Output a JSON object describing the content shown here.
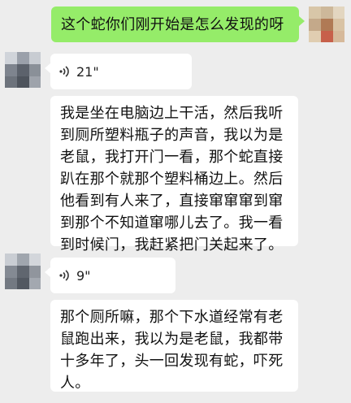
{
  "messages": [
    {
      "from": "me",
      "type": "text",
      "text": "这个蛇你们刚开始是怎么发现的呀"
    },
    {
      "from": "other",
      "type": "voice",
      "duration": "21\""
    },
    {
      "from": "other",
      "type": "text",
      "text": "我是坐在电脑边上干活，然后我听到厕所塑料瓶子的声音，我以为是老鼠，我打开门一看，那个蛇直接趴在那个就那个塑料桶边上。然后他看到有人来了，直接窜窜窜到窜到那个不知道窜哪儿去了。我一看到时候门，我赶紧把门关起来了。"
    },
    {
      "from": "other",
      "type": "voice",
      "duration": "9\""
    },
    {
      "from": "other",
      "type": "text",
      "text": "那个厕所嘛，那个下水道经常有老鼠跑出来，我以为是老鼠，我都带十多年了，头一回发现有蛇，吓死人。"
    }
  ],
  "colors": {
    "me_bubble": "#95ec69",
    "other_bubble": "#ffffff",
    "background": "#ededed"
  },
  "icons": {
    "voice": "voice-wave-icon"
  }
}
